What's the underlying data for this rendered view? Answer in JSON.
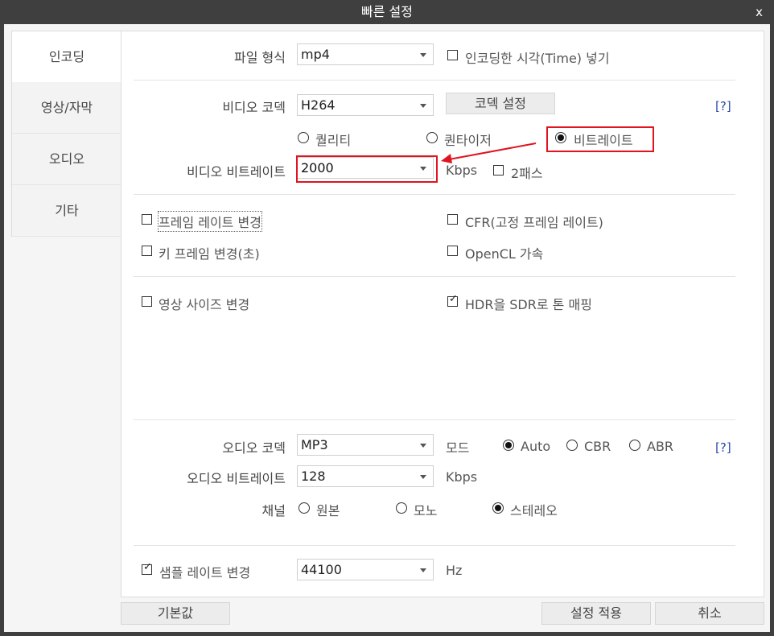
{
  "window": {
    "title": "빠른 설정",
    "close_label": "x"
  },
  "sidebar": {
    "items": [
      {
        "label": "인코딩",
        "active": true
      },
      {
        "label": "영상/자막",
        "active": false
      },
      {
        "label": "오디오",
        "active": false
      },
      {
        "label": "기타",
        "active": false
      }
    ]
  },
  "format": {
    "label": "파일 형식",
    "value": "mp4",
    "insert_time_label": "인코딩한 시각(Time) 넣기",
    "insert_time_checked": false
  },
  "video": {
    "codec_label": "비디오 코덱",
    "codec_value": "H264",
    "codec_settings_button": "코덱 설정",
    "help": "[?]",
    "mode_options": [
      "퀄리티",
      "퀀타이저",
      "비트레이트"
    ],
    "mode_selected": "비트레이트",
    "bitrate_label": "비디오 비트레이트",
    "bitrate_value": "2000",
    "bitrate_unit": "Kbps",
    "two_pass_label": "2패스",
    "two_pass_checked": false
  },
  "video_options": {
    "change_framerate": {
      "label": "프레임 레이트 변경",
      "checked": false
    },
    "cfr": {
      "label": "CFR(고정 프레임 레이트)",
      "checked": false
    },
    "change_keyframe": {
      "label": "키 프레임 변경(초)",
      "checked": false
    },
    "opencl": {
      "label": "OpenCL 가속",
      "checked": false
    },
    "change_size": {
      "label": "영상 사이즈 변경",
      "checked": false
    },
    "hdr_to_sdr": {
      "label": "HDR을 SDR로 톤 매핑",
      "checked": true
    }
  },
  "audio": {
    "codec_label": "오디오 코덱",
    "codec_value": "MP3",
    "mode_label": "모드",
    "mode_options": [
      "Auto",
      "CBR",
      "ABR"
    ],
    "mode_selected": "Auto",
    "help": "[?]",
    "bitrate_label": "오디오 비트레이트",
    "bitrate_value": "128",
    "bitrate_unit": "Kbps",
    "channel_label": "채널",
    "channel_options": [
      "원본",
      "모노",
      "스테레오"
    ],
    "channel_selected": "스테레오",
    "samplerate_label": "샘플 레이트 변경",
    "samplerate_checked": true,
    "samplerate_value": "44100",
    "samplerate_unit": "Hz"
  },
  "footer": {
    "default_button": "기본값",
    "apply_button": "설정 적용",
    "cancel_button": "취소"
  },
  "colors": {
    "titlebar": "#3f3f3f",
    "highlight": "#e0141e",
    "help_link": "#2a4ca8"
  }
}
